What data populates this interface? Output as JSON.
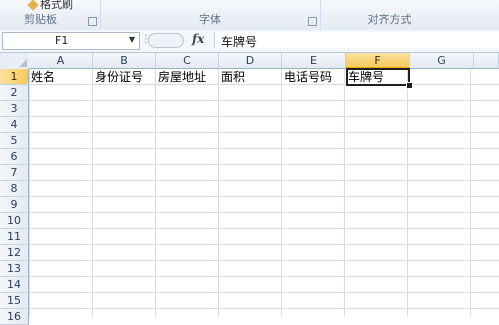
{
  "ribbon": {
    "groups": [
      {
        "label": "剪贴板"
      },
      {
        "label": "字体"
      },
      {
        "label": "对齐方式"
      }
    ],
    "format_painter_label": "格式刷"
  },
  "formula_bar": {
    "name_box": "F1",
    "fx": "fx",
    "value": "车牌号"
  },
  "grid": {
    "columns": [
      "A",
      "B",
      "C",
      "D",
      "E",
      "F",
      "G"
    ],
    "selected_column": "F",
    "rows": [
      "1",
      "2",
      "3",
      "4",
      "5",
      "6",
      "7",
      "8",
      "9",
      "10",
      "11",
      "12",
      "13",
      "14",
      "15",
      "16"
    ],
    "selected_row": "1",
    "row1": [
      "姓名",
      "身份证号",
      "房屋地址",
      "面积",
      "电话号码",
      "车牌号",
      ""
    ]
  }
}
